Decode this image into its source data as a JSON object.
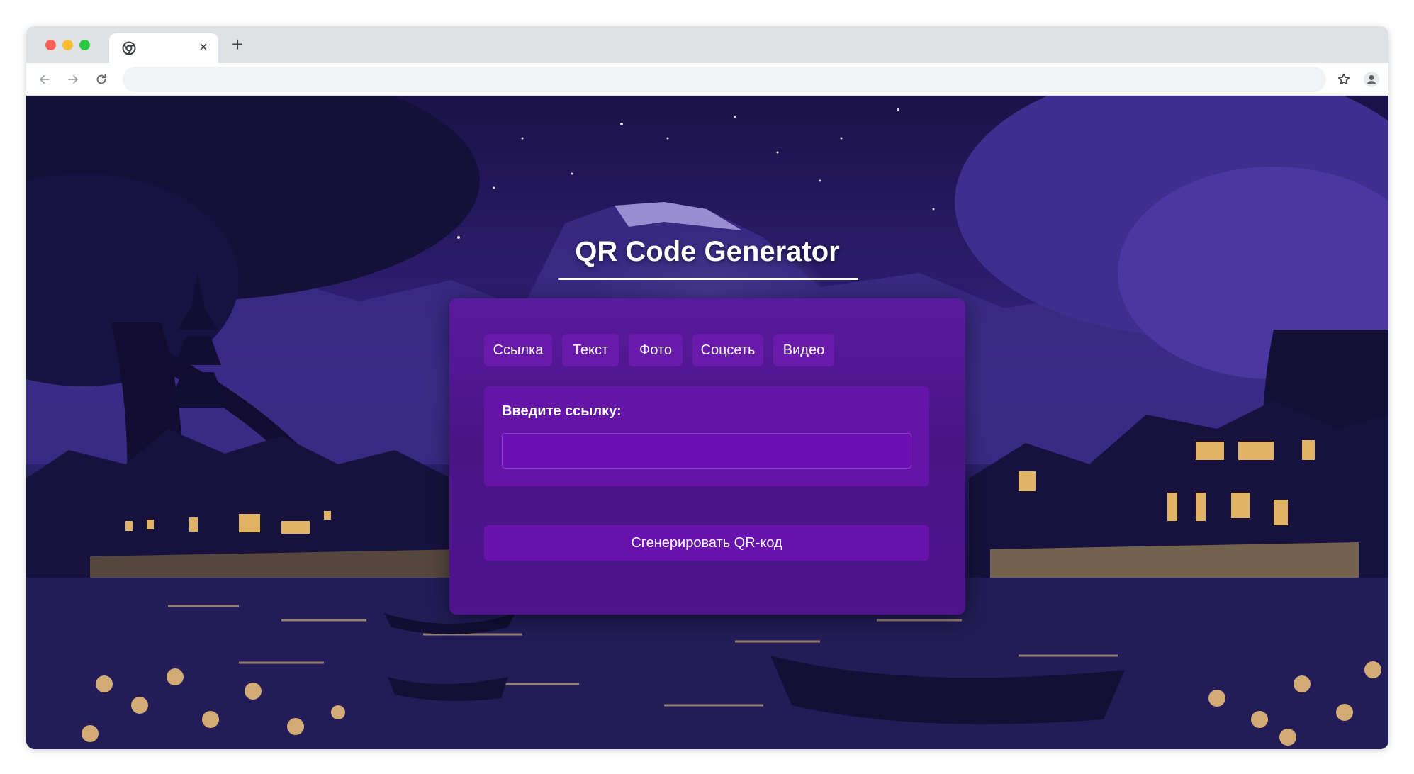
{
  "browser": {
    "tab_close_glyph": "×",
    "new_tab_glyph": "+",
    "url": "",
    "icons": {
      "back": "arrow-left-icon",
      "forward": "arrow-right-icon",
      "reload": "reload-icon",
      "bookmark": "star-icon",
      "profile": "profile-icon",
      "menu": "kebab-menu-icon",
      "favicon": "chrome-icon"
    }
  },
  "page": {
    "title": "QR Code Generator",
    "type_tabs": [
      {
        "label": "Ссылка"
      },
      {
        "label": "Текст"
      },
      {
        "label": "Фото"
      },
      {
        "label": "Соцсеть"
      },
      {
        "label": "Видео"
      }
    ],
    "input": {
      "label": "Введите ссылку:",
      "value": "",
      "placeholder": ""
    },
    "generate_button": "Сгенерировать QR-код"
  },
  "colors": {
    "card": "#4e138d",
    "tab_button": "#6a1aab",
    "input_panel": "#6414a6",
    "generate_button": "#6813ad"
  }
}
